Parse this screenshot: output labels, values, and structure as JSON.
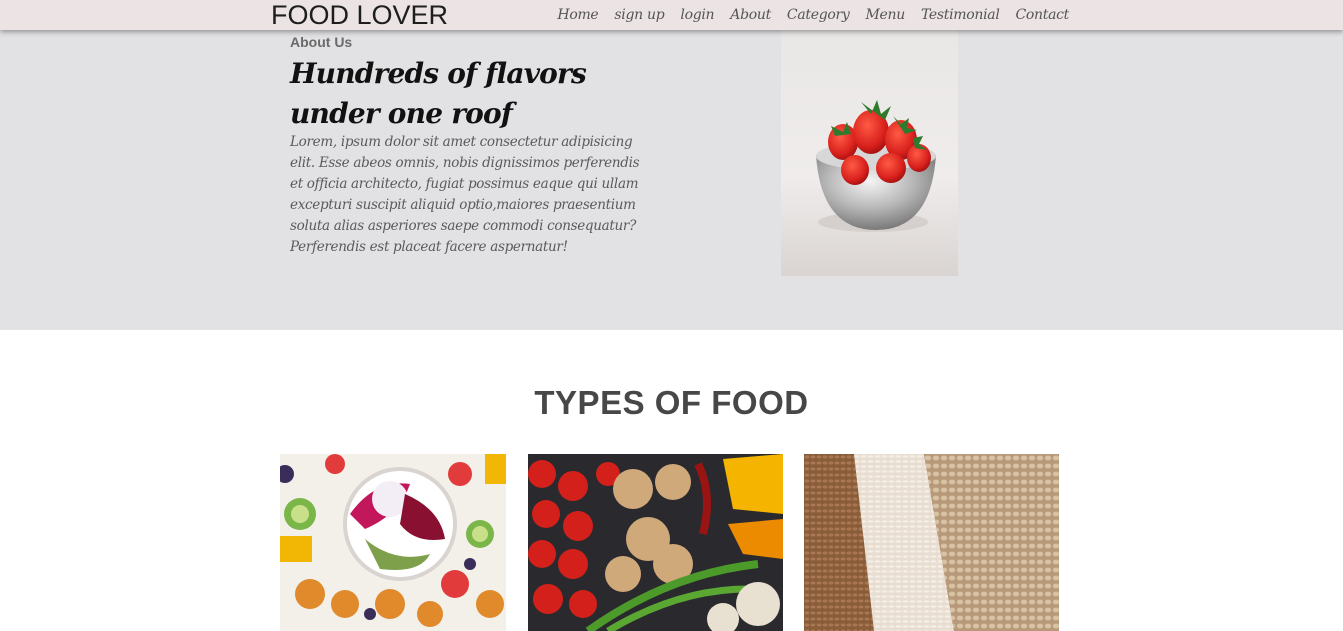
{
  "navbar": {
    "brand": "FOOD LOVER",
    "links": [
      "Home",
      "sign up",
      "login",
      "About",
      "Category",
      "Menu",
      "Testimonial",
      "Contact"
    ]
  },
  "about": {
    "tag": "About Us",
    "heading": "Hundreds of flavors under one roof",
    "text": "Lorem, ipsum dolor sit amet consectetur adipisicing elit. Esse abeos omnis, nobis dignissimos perferendis et officia architecto, fugiat possimus eaque qui ullam excepturi suscipit aliquid optio,maiores praesentium soluta alias asperiores saepe commodi consequatur? Perferendis est placeat facere aspernatur!",
    "image": "strawberry-bowl-photo"
  },
  "types": {
    "title": "TYPES OF FOOD",
    "cards": [
      {
        "image": "fruit-bowl-photo"
      },
      {
        "image": "vegetables-photo"
      },
      {
        "image": "grains-photo"
      }
    ]
  },
  "colors": {
    "navbar_bg": "#ece4e4",
    "about_bg": "#e2e2e4",
    "page_bg": "#ffffff"
  }
}
